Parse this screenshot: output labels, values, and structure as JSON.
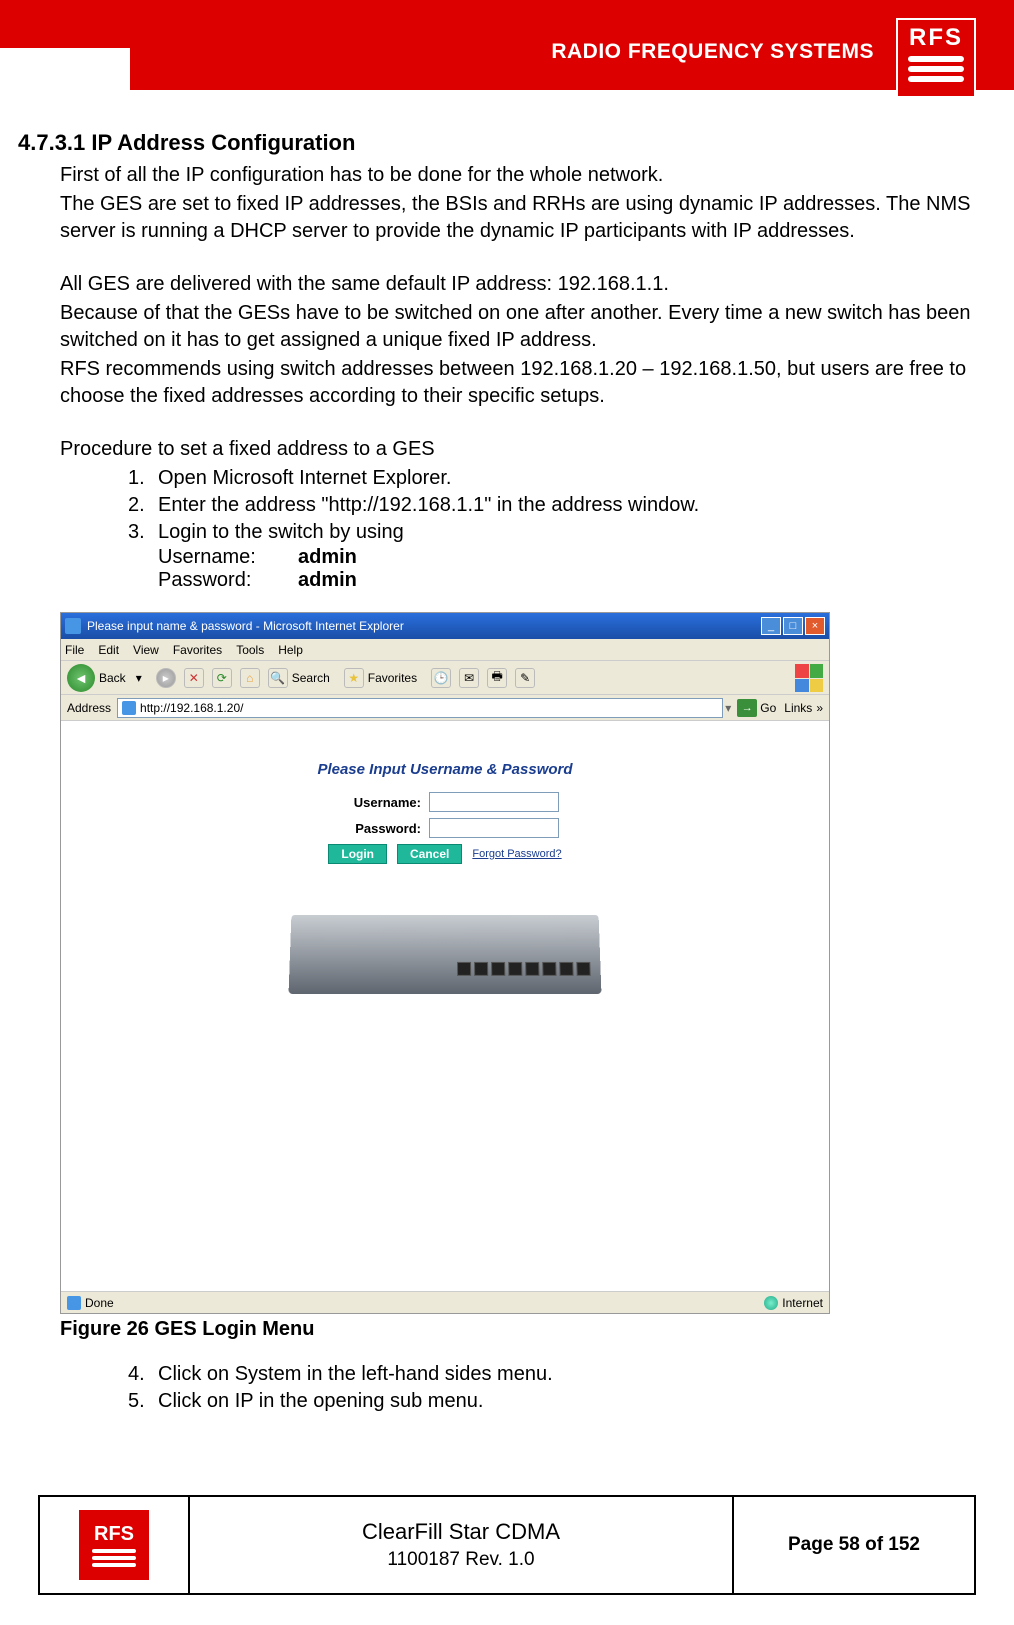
{
  "header": {
    "brand_text": "RADIO FREQUENCY SYSTEMS",
    "logo_text": "RFS"
  },
  "section": {
    "number": "4.7.3.1",
    "title": "IP Address Configuration",
    "para1": "First of all the IP configuration has to be done for the whole network.",
    "para2": "The GES are set to fixed IP addresses, the BSIs and RRHs are using dynamic IP addresses. The NMS server is running a DHCP server to provide the dynamic IP participants with IP addresses.",
    "para3": "All GES are delivered with the same default IP address: 192.168.1.1.",
    "para4": "Because of that the GESs have to be switched on one after another. Every time a new switch has been switched on it has to get assigned a unique fixed IP address.",
    "para5": "RFS recommends using switch addresses between 192.168.1.20 – 192.168.1.50, but users are free to choose the fixed addresses according to their specific setups.",
    "proc_title": "Procedure to set a fixed address to a GES",
    "steps": [
      "Open Microsoft Internet Explorer.",
      "Enter the address \"http://192.168.1.1\" in the address window.",
      "Login to the switch by using"
    ],
    "credentials": {
      "username_label": "Username:",
      "username_value": "admin",
      "password_label": "Password:",
      "password_value": "admin"
    },
    "steps_after": [
      "Click on System in the left-hand sides menu.",
      "Click on IP in the opening sub menu."
    ],
    "figure_caption": "Figure 26 GES Login Menu"
  },
  "browser": {
    "title": "Please input name & password - Microsoft Internet Explorer",
    "menu": [
      "File",
      "Edit",
      "View",
      "Favorites",
      "Tools",
      "Help"
    ],
    "toolbar": {
      "back": "Back",
      "search": "Search",
      "favorites": "Favorites"
    },
    "address_label": "Address",
    "address_value": "http://192.168.1.20/",
    "go_label": "Go",
    "links_label": "Links",
    "login": {
      "title": "Please Input Username & Password",
      "username_label": "Username:",
      "password_label": "Password:",
      "login_btn": "Login",
      "cancel_btn": "Cancel",
      "forgot": "Forgot Password?"
    },
    "status_done": "Done",
    "status_zone": "Internet"
  },
  "footer": {
    "logo_text": "RFS",
    "title": "ClearFill Star CDMA",
    "subtitle": "1100187 Rev. 1.0",
    "page": "Page 58 of 152"
  }
}
